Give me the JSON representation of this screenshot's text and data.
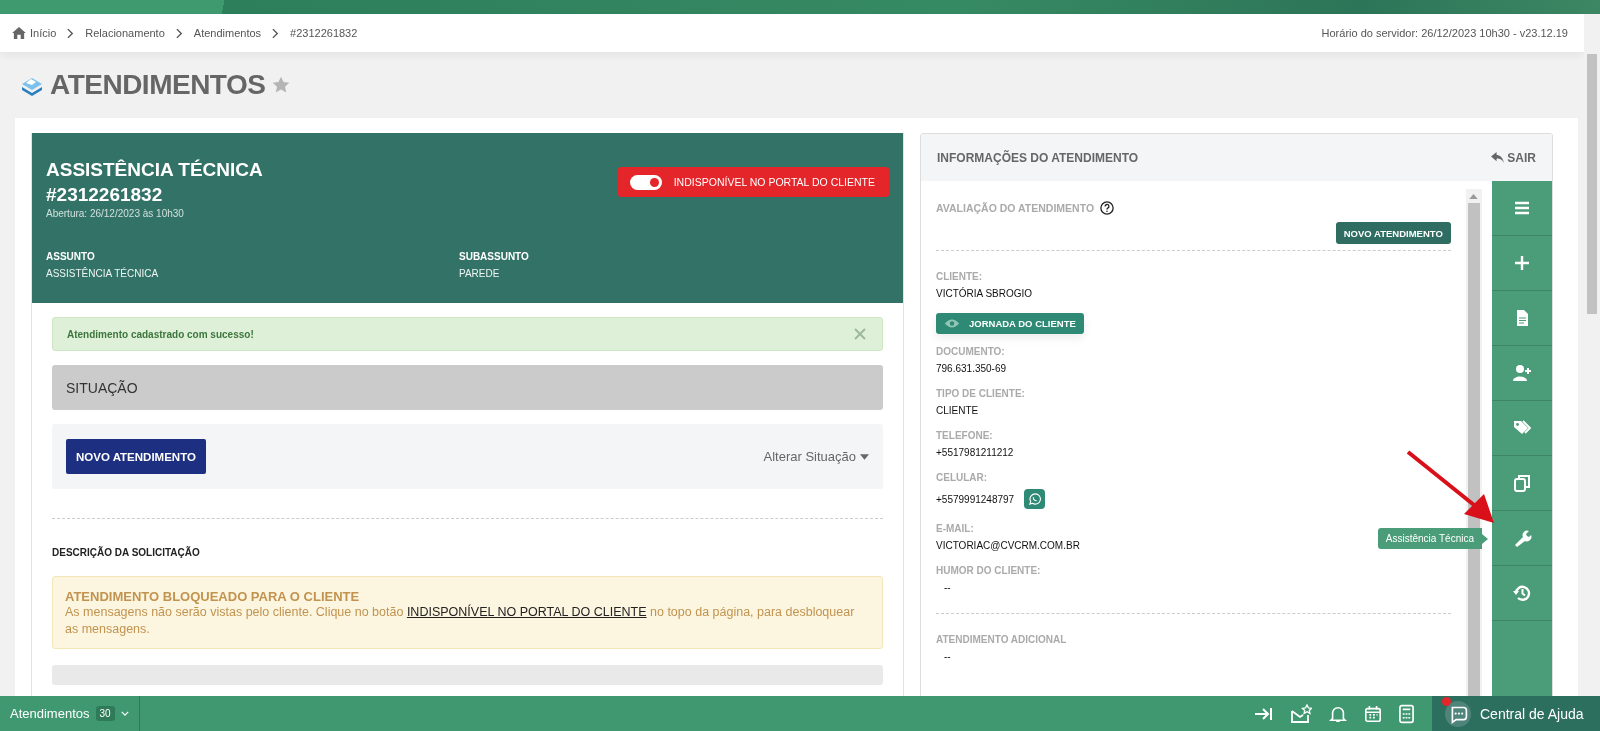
{
  "breadcrumb": {
    "items": [
      {
        "label": "Início",
        "kind": "home"
      },
      {
        "label": "Relacionamento",
        "kind": "link"
      },
      {
        "label": "Atendimentos",
        "kind": "link"
      },
      {
        "label": "#2312261832",
        "kind": "current"
      }
    ],
    "server_info": "Horário do servidor: 26/12/2023 10h30 - v23.12.19"
  },
  "page_title": "ATENDIMENTOS",
  "ticket": {
    "title": "ASSISTÊNCIA TÉCNICA",
    "number": "#2312261832",
    "opened": "Abertura: 26/12/2023 às 10h30",
    "portal_toggle": {
      "label": "INDISPONÍVEL NO PORTAL DO CLIENTE",
      "on": true
    },
    "fields": [
      {
        "label": "ASSUNTO",
        "value": "ASSISTÊNCIA TÉCNICA"
      },
      {
        "label": "SUBASSUNTO",
        "value": "PAREDE"
      }
    ]
  },
  "success_alert": "Atendimento cadastrado com sucesso!",
  "situation": "SITUAÇÃO",
  "new_button": "NOVO ATENDIMENTO",
  "change_status": "Alterar Situação",
  "section_title": "DESCRIÇÃO DA SOLICITAÇÃO",
  "warning": {
    "title": "ATENDIMENTO BLOQUEADO PARA O CLIENTE",
    "text_before": "As mensagens não serão vistas pelo cliente. Clique no botão",
    "link": "INDISPONÍVEL NO PORTAL DO CLIENTE",
    "text_after": "no topo da página, para desbloquear as mensagens."
  },
  "info_panel": {
    "title": "INFORMAÇÕES DO ATENDIMENTO",
    "exit": "SAIR",
    "rating_label": "AVALIAÇÃO DO ATENDIMENTO",
    "rating_button": "NOVO ATENDIMENTO",
    "items": [
      {
        "kind": "field",
        "label": "CLIENTE:",
        "value": "VICTÓRIA SBROGIO"
      },
      {
        "kind": "button",
        "label": "JORNADA DO CLIENTE"
      },
      {
        "kind": "field",
        "label": "DOCUMENTO:",
        "value": "796.631.350-69"
      },
      {
        "kind": "field",
        "label": "TIPO DE CLIENTE:",
        "value": "CLIENTE"
      },
      {
        "kind": "field",
        "label": "TELEFONE:",
        "value": "+5517981211212"
      },
      {
        "kind": "whatsapp",
        "label": "CELULAR:",
        "value": "+5579991248797"
      },
      {
        "kind": "field",
        "label": "E-MAIL:",
        "value": "VICTORIAC@CVCRM.COM.BR"
      },
      {
        "kind": "field",
        "label": "HUMOR DO CLIENTE:",
        "value": "--"
      },
      {
        "kind": "divider"
      },
      {
        "kind": "field",
        "label": "ATENDIMENTO ADICIONAL",
        "value": "--"
      }
    ],
    "tools": [
      {
        "kind": "menu"
      },
      {
        "kind": "add"
      },
      {
        "kind": "document"
      },
      {
        "kind": "add-user"
      },
      {
        "kind": "tags"
      },
      {
        "kind": "copy"
      },
      {
        "kind": "wrench",
        "tooltip": "Assistência Técnica"
      },
      {
        "kind": "history"
      }
    ]
  },
  "bottom_bar": {
    "tab": "Atendimentos",
    "count": "30",
    "help": "Central de Ajuda",
    "help_notification": true
  }
}
